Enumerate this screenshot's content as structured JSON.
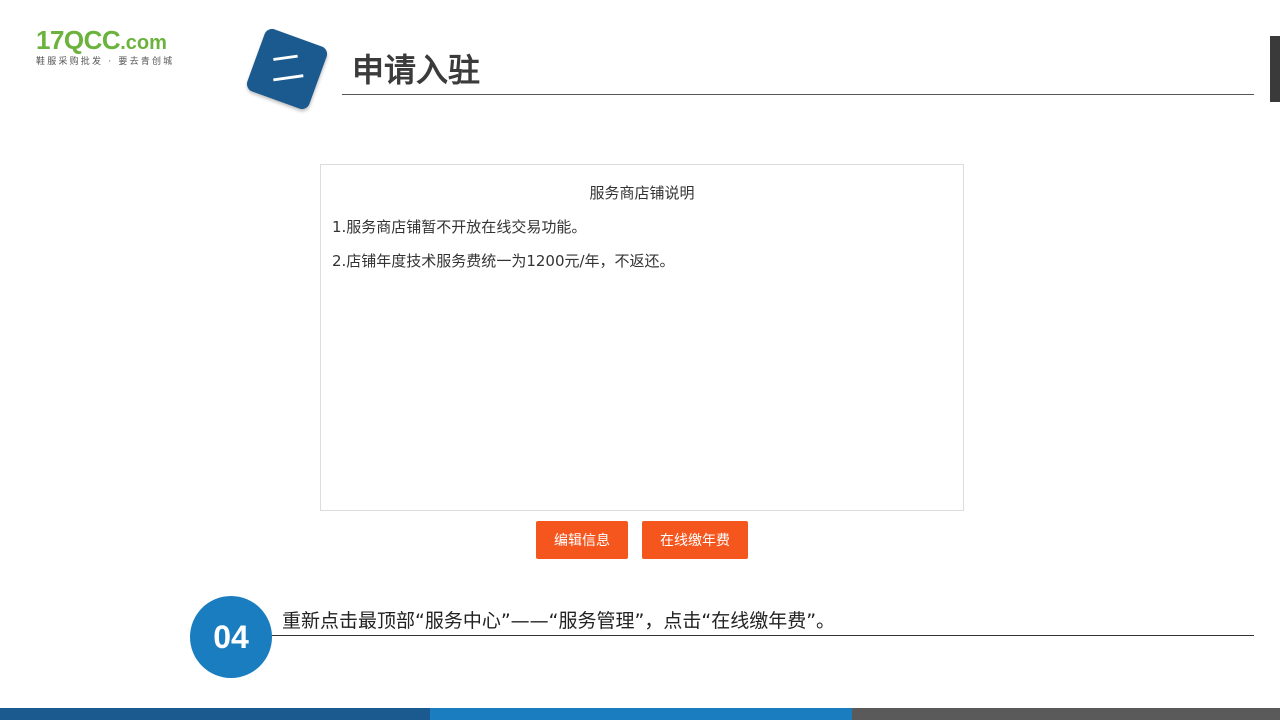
{
  "logo": {
    "part1": "17",
    "part2": "QCC",
    "domain": ".com",
    "tagline": "鞋服采购批发 · 要去青创城"
  },
  "section": {
    "badge": "二",
    "title": "申请入驻"
  },
  "panel": {
    "title": "服务商店铺说明",
    "lines": [
      "1.服务商店铺暂不开放在线交易功能。",
      "2.店铺年度技术服务费统一为1200元/年，不返还。"
    ]
  },
  "buttons": {
    "edit_label": "编辑信息",
    "pay_label": "在线缴年费"
  },
  "step": {
    "number": "04",
    "text": "重新点击最顶部“服务中心”——“服务管理”，点击“在线缴年费”。"
  },
  "colors": {
    "logo_green": "#6cb33e",
    "logo_blue": "#2d9ad6",
    "badge_blue": "#1a5a8e",
    "button_orange": "#f5561e",
    "step_blue": "#1a7dc0"
  }
}
